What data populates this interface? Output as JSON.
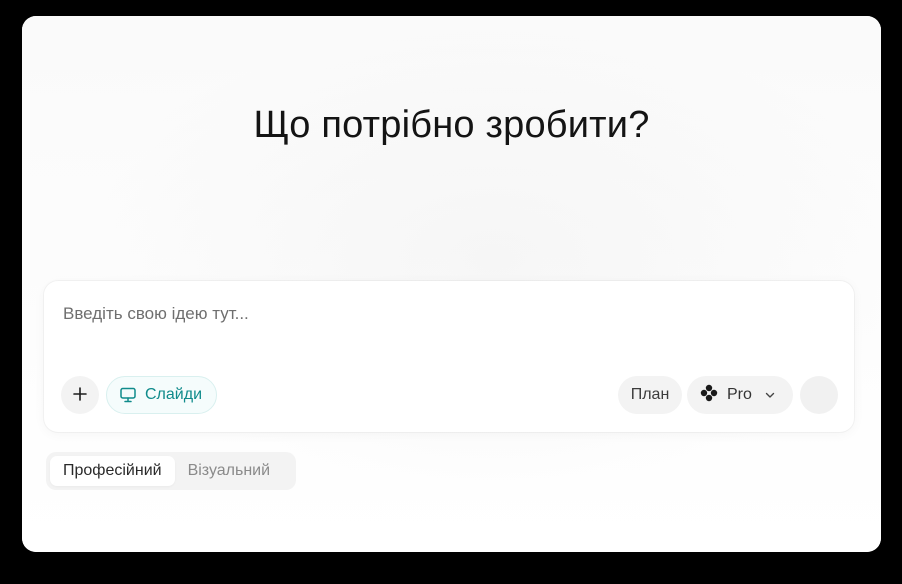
{
  "main": {
    "heading": "Що потрібно зробити?"
  },
  "composer": {
    "placeholder": "Введіть свою ідею тут...",
    "add_icon": "plus-icon",
    "slides_chip": {
      "label": "Слайди",
      "icon": "presentation-icon",
      "color": "#0f8b8b"
    },
    "plan_label": "План",
    "model": {
      "label": "Pro",
      "icon": "flower-icon",
      "chevron": "chevron-down-icon"
    },
    "send_icon": "send-icon"
  },
  "modes": {
    "tabs": [
      {
        "label": "Професійний",
        "active": true
      },
      {
        "label": "Візуальний",
        "active": false
      }
    ]
  }
}
